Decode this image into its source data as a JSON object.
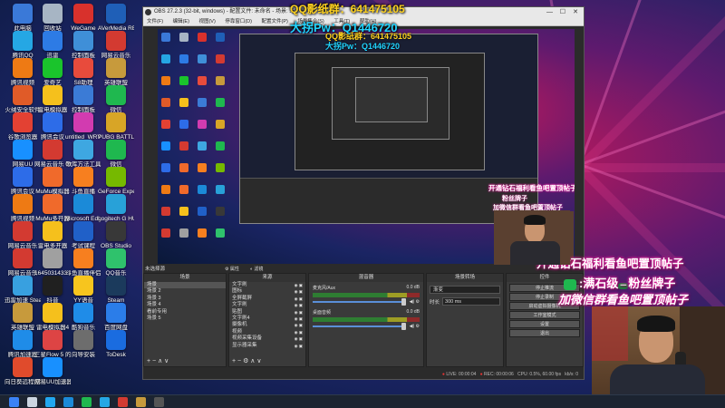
{
  "desktop": {
    "icons": [
      {
        "label": "此电脑",
        "color": "#3a79d8"
      },
      {
        "label": "回收站",
        "color": "#a7b5c4"
      },
      {
        "label": "WeGame",
        "color": "#d8312c"
      },
      {
        "label": "AVerMedia RECentral 4",
        "color": "#1f5fb7"
      },
      {
        "label": "腾讯QQ",
        "color": "#25a7e4"
      },
      {
        "label": "迅雷",
        "color": "#2d7be5"
      },
      {
        "label": "控制面板",
        "color": "#3f8fd8"
      },
      {
        "label": "网易云音乐",
        "color": "#d33a31"
      },
      {
        "label": "腾讯视频",
        "color": "#ee7a14"
      },
      {
        "label": "爱奇艺",
        "color": "#1ac42c"
      },
      {
        "label": "S8助理",
        "color": "#e84b3c"
      },
      {
        "label": "英雄联盟",
        "color": "#c79a3c"
      },
      {
        "label": "火绒安全软件",
        "color": "#e05b28"
      },
      {
        "label": "雷电模拟器",
        "color": "#f5c01c"
      },
      {
        "label": "控制面板",
        "color": "#3b7bd6"
      },
      {
        "label": "微信",
        "color": "#1fb84f"
      },
      {
        "label": "谷歌浏览器",
        "color": "#e34133"
      },
      {
        "label": "腾讯会议",
        "color": "#2d6ce8"
      },
      {
        "label": "untitled_WRY4",
        "color": "#d23bb0"
      },
      {
        "label": "PUBG BATTLEGROUNDS",
        "color": "#d8a526"
      },
      {
        "label": "网易UU",
        "color": "#1890ff"
      },
      {
        "label": "网易云音乐 010",
        "color": "#d33a31"
      },
      {
        "label": "歌库方法工具",
        "color": "#3ea7e1"
      },
      {
        "label": "微信",
        "color": "#1fb84f"
      },
      {
        "label": "腾讯会议",
        "color": "#2d6ce8"
      },
      {
        "label": "MuMu模拟器",
        "color": "#f06a2b"
      },
      {
        "label": "斗鱼直播",
        "color": "#f77f1f"
      },
      {
        "label": "GeForce Experience",
        "color": "#76b900"
      },
      {
        "label": "腾讯视频",
        "color": "#ee7a14"
      },
      {
        "label": "MuMu多开器",
        "color": "#f06a2b"
      },
      {
        "label": "Microsoft Edge",
        "color": "#1b8ad8"
      },
      {
        "label": "Logitech G HUB",
        "color": "#28a1d8"
      },
      {
        "label": "网易云音乐",
        "color": "#d33a31"
      },
      {
        "label": "雷电多开器",
        "color": "#f5c01c"
      },
      {
        "label": "考试课程",
        "color": "#2060c8"
      },
      {
        "label": "OBS Studio",
        "color": "#383838"
      },
      {
        "label": "网易云音乐",
        "color": "#d33a31"
      },
      {
        "label": "1645031433 1360011",
        "color": "#a0a0a0"
      },
      {
        "label": "斗鱼直播伴侣",
        "color": "#f77f1f"
      },
      {
        "label": "QQ音乐",
        "color": "#2fc26c"
      },
      {
        "label": "迅雷加速 Steam",
        "color": "#38a0e0"
      },
      {
        "label": "抖音",
        "color": "#202020"
      },
      {
        "label": "YY语音",
        "color": "#f7c51e"
      },
      {
        "label": "Steam",
        "color": "#1b3a5c"
      },
      {
        "label": "英雄联盟",
        "color": "#c79a3c"
      },
      {
        "label": "雷电模拟器4",
        "color": "#f5c01c"
      },
      {
        "label": "酷狗音乐",
        "color": "#1f8ce8"
      },
      {
        "label": "百度网盘",
        "color": "#2b7de9"
      },
      {
        "label": "腾讯加速器",
        "color": "#1f8ce8"
      },
      {
        "label": "三星Flow 5 的帐号",
        "color": "#d44"
      },
      {
        "label": "向导安装",
        "color": "#6d6d6d"
      },
      {
        "label": "ToDesk",
        "color": "#1a6ce0"
      },
      {
        "label": "向日葵远程控制",
        "color": "#e04b2c"
      },
      {
        "label": "网易UU加速器",
        "color": "#1890ff"
      }
    ]
  },
  "obs": {
    "title": "OBS 27.2.3 (32-bit, windows) - 配置文件: 未命名 - 场景: 未命名",
    "menu": [
      "文件(F)",
      "编辑(E)",
      "视图(V)",
      "停靠窗口(D)",
      "配置文件(P)",
      "场景集合(S)",
      "工具(T)",
      "帮助(H)"
    ],
    "window_controls": [
      "—",
      "☐",
      "✕"
    ],
    "left_panel_title": "未选择源",
    "props_btn": "属性",
    "filter_btn": "滤镜",
    "scenes_header": "场景",
    "scenes": [
      "场景",
      "场景 2",
      "场景 3",
      "场景 4",
      "看前专用",
      "场景 5"
    ],
    "sources_header": "来源",
    "sources": [
      "文字刷",
      "图标",
      "全屏截屏",
      "文字刷",
      "贴图",
      "文字刷4",
      "摄像机",
      "视频",
      "视频采集设备",
      "显示器采集"
    ],
    "mixer_header": "混音器",
    "mixer_tracks": [
      {
        "name": "麦克风/Aux",
        "level": "0.0 dB"
      },
      {
        "name": "桌面音频",
        "level": "0.0 dB"
      }
    ],
    "transition_header": "场景转场",
    "transition_type": "渐变",
    "duration_label": "时长",
    "duration_value": "300 ms",
    "controls_header": "控件",
    "controls": [
      "停止推流",
      "停止录制",
      "启动虚拟摄像机",
      "工作室模式",
      "设置",
      "退出"
    ],
    "status": {
      "live": "LIVE: 00:00:04",
      "rec": "REC: 00:00:06",
      "cpu": "CPU: 0.5%, 60.00 fps",
      "kb": "kb/s: 0"
    }
  },
  "overlays": {
    "qq_line": "QQ影纸群：641475105",
    "pw_line": "大拐Pw：Q1446720",
    "banner1": "开通钻石福利看鱼吧置顶帖子",
    "badge": ":满石级",
    "badge_mid": "一",
    "badge_tail": "粉丝牌子",
    "banner2": "加微信群看鱼吧置顶帖子",
    "colors": {
      "qq": "#ffd21f",
      "pw": "#20d4ff",
      "banner": "#ffffff",
      "outline": "#f01ea0"
    }
  },
  "taskbar": {
    "apps": [
      "start-icon",
      "search-icon",
      "widgets-icon",
      "edge-icon",
      "wechat-icon",
      "qq-icon",
      "netease-icon",
      "lol-icon",
      "obs-icon"
    ]
  }
}
